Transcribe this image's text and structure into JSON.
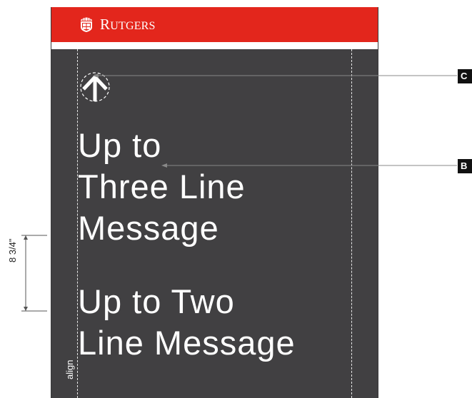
{
  "header": {
    "wordmark_initial": "R",
    "wordmark_rest": "UTGERS",
    "logo_icon": "rutgers-shield-icon",
    "background": "#e3261c"
  },
  "sign": {
    "background": "#414042",
    "direction_icon": "up-arrow-icon",
    "three_line_message": [
      "Up to",
      "Three Line",
      "Message"
    ],
    "two_line_message": [
      "Up to Two",
      "Line Message"
    ],
    "align_label": "align"
  },
  "callouts": {
    "c": "C",
    "b": "B"
  },
  "dimension": {
    "label": "8 3/4\""
  }
}
